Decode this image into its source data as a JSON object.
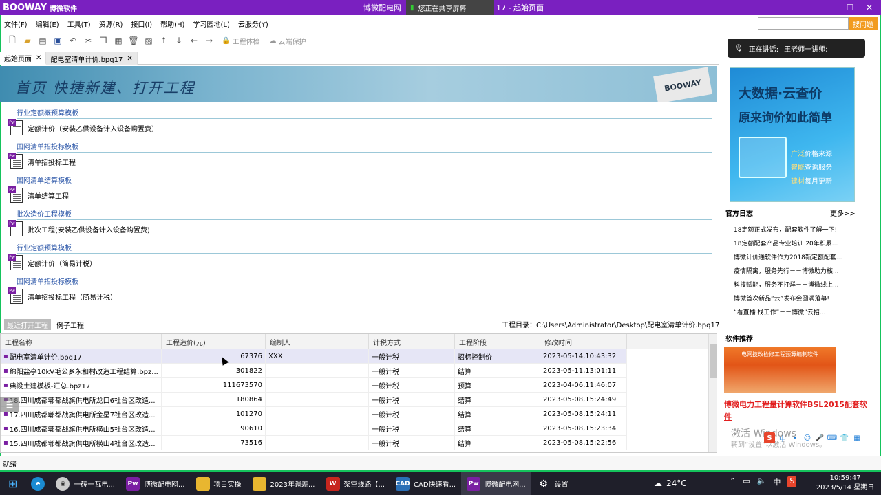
{
  "app": {
    "logo_text": "BOOWAY",
    "logo_sub": "博微软件",
    "title_left": "博微配电网",
    "title_right": "17  -  起始页面",
    "share_text": "您正在共享屏幕",
    "min": "—",
    "max": "☐",
    "close": "✕"
  },
  "menu": [
    "文件(F)",
    "编辑(E)",
    "工具(T)",
    "资源(R)",
    "接口(I)",
    "帮助(H)",
    "学习园地(L)",
    "云服务(Y)"
  ],
  "search": {
    "placeholder": "",
    "button": "搜问题"
  },
  "toolbar": {
    "check": "工程体检",
    "cloud": "云端保护"
  },
  "speaking": {
    "label": "正在讲话:",
    "name": "王老师一讲师;"
  },
  "tabs": [
    {
      "label": "起始页面",
      "close": "✕"
    },
    {
      "label": "配电室清单计价.bpq17",
      "close": "✕"
    }
  ],
  "banner": {
    "text": "首页  快捷新建、打开工程",
    "logo": "BOOWAY"
  },
  "templates": [
    {
      "section": "行业定额概预算模板",
      "item": "定额计价（安装乙供设备计入设备购置费）"
    },
    {
      "section": "国网清单招投标模板",
      "item": "清单招投标工程"
    },
    {
      "section": "国网清单结算模板",
      "item": "清单结算工程"
    },
    {
      "section": "批次造价工程模板",
      "item": "批次工程(安装乙供设备计入设备购置费)"
    },
    {
      "section": "行业定额预算模板",
      "item": "定额计价（简易计税）"
    },
    {
      "section": "国网清单招投标模板",
      "item": "清单招投标工程（简易计税）"
    }
  ],
  "bottom_tabs": {
    "recent": "最近打开工程",
    "example": "例子工程"
  },
  "project_dir": "工程目录：C:\\Users\\Administrator\\Desktop\\配电室清单计价.bpq17",
  "table": {
    "headers": [
      "工程名称",
      "工程造价(元)",
      "编制人",
      "计税方式",
      "工程阶段",
      "修改时间"
    ],
    "rows": [
      [
        "配电室清单计价.bpq17",
        "67376",
        "XXX",
        "一般计税",
        "招标控制价",
        "2023-05-14,10:43:32"
      ],
      [
        "绵阳盐亭10kV毛公乡永和村改造工程结算.bpz...",
        "301822",
        "",
        "一般计税",
        "结算",
        "2023-05-11,13:01:11"
      ],
      [
        "典设土建模板-汇总.bpz17",
        "111673570",
        "",
        "一般计税",
        "预算",
        "2023-04-06,11:46:07"
      ],
      [
        "18.四川成都郫都战旗供电所龙口6社台区改造...",
        "180864",
        "",
        "一般计税",
        "结算",
        "2023-05-08,15:24:49"
      ],
      [
        "17.四川成都郫都战旗供电所金星7社台区改造...",
        "101270",
        "",
        "一般计税",
        "结算",
        "2023-05-08,15:24:11"
      ],
      [
        "16.四川成都郫都战旗供电所横山5社台区改造...",
        "90610",
        "",
        "一般计税",
        "结算",
        "2023-05-08,15:23:34"
      ],
      [
        "15.四川成都郫都战旗供电所横山4社台区改造...",
        "73516",
        "",
        "一般计税",
        "结算",
        "2023-05-08,15:22:56"
      ]
    ]
  },
  "status": "就绪",
  "ad": {
    "title1": "大数据·云查价",
    "title2": "原来询价如此简单",
    "line1_a": "广泛",
    "line1_b": "价格来源",
    "line2_a": "智能",
    "line2_b": "查询服务",
    "line3_a": "建材",
    "line3_b": "每月更新"
  },
  "news": {
    "title": "官方日志",
    "more": "更多>>",
    "items": [
      "18定额正式发布，配套软件了解一下!",
      "18定额配套产品专业培训 20年积累...",
      "博微计价通软件作为2018新定额配套...",
      "疫情隔离，服务先行－－博微助力核...",
      "科技赋能，服务不打烊－－博微线上...",
      "博微首次新品“云”发布会圆满落幕!",
      "“看直播  找工作”－－博微“云招..."
    ]
  },
  "reco": {
    "title": "软件推荐",
    "img_text": "电网技改检修工程预算编制软件",
    "link": "博微电力工程量计算软件BSL2015配套软件"
  },
  "watermark": {
    "line1": "激活 Windows",
    "line2": "转到“设置”以激活 Windows。"
  },
  "ime": {
    "s": "S",
    "lang": "中"
  },
  "taskbar": {
    "items": [
      "一砖一瓦电...",
      "博微配电网...",
      "项目实操",
      "2023年调差...",
      "架空线路【...",
      "CAD快速看...",
      "博微配电网...",
      "设置"
    ]
  },
  "weather": {
    "temp": "24°C"
  },
  "tray": {
    "lang": "中",
    "s": "S"
  },
  "clock": {
    "time": "10:59:47",
    "date": "2023/5/14 星期日"
  },
  "colors": {
    "titlebar": "#7a20c0",
    "accent": "#15c35c",
    "link": "#e21f1f",
    "search_btn": "#f29b1f"
  }
}
